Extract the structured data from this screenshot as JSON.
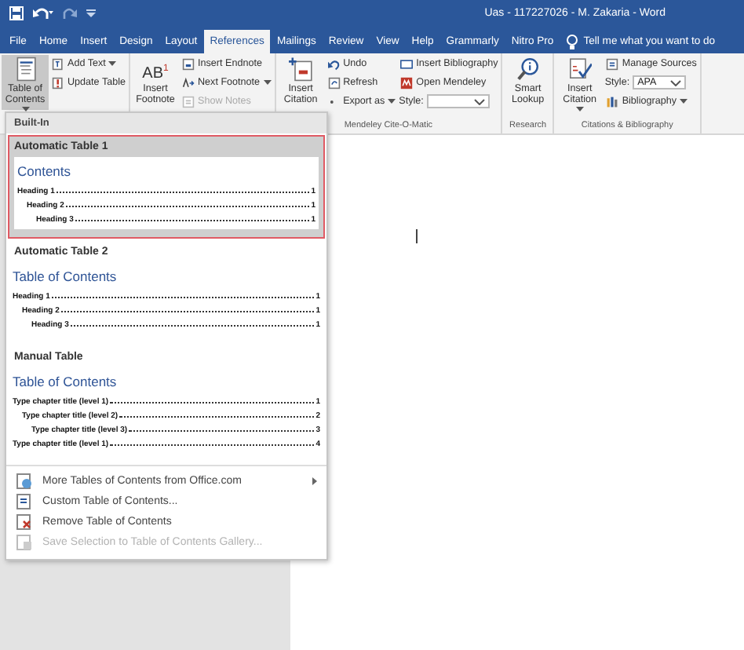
{
  "title_bar": {
    "title": "Uas - 117227026 - M. Zakaria  -  Word"
  },
  "tabs": [
    {
      "label": "File",
      "selected": false
    },
    {
      "label": "Home",
      "selected": false
    },
    {
      "label": "Insert",
      "selected": false
    },
    {
      "label": "Design",
      "selected": false
    },
    {
      "label": "Layout",
      "selected": false
    },
    {
      "label": "References",
      "selected": true
    },
    {
      "label": "Mailings",
      "selected": false
    },
    {
      "label": "Review",
      "selected": false
    },
    {
      "label": "View",
      "selected": false
    },
    {
      "label": "Help",
      "selected": false
    },
    {
      "label": "Grammarly",
      "selected": false
    },
    {
      "label": "Nitro Pro",
      "selected": false
    }
  ],
  "tell_me": "Tell me what you want to do",
  "ribbon_groups": [
    {
      "columns": [
        [
          {
            "kind": "large",
            "label": "Table of Contents",
            "dropdown": true,
            "pressed": true
          }
        ],
        [
          {
            "kind": "small",
            "label": "Add Text",
            "dropdown": true
          },
          {
            "kind": "small",
            "label": "Update Table"
          }
        ]
      ]
    },
    {
      "columns": [
        [
          {
            "kind": "large",
            "label": "Insert Footnote",
            "icon_text": "AB$^{1}$"
          }
        ],
        [
          {
            "kind": "small",
            "label": "Insert Endnote"
          },
          {
            "kind": "small",
            "label": "Next Footnote",
            "dropdown": true
          },
          {
            "kind": "small",
            "label": "Show Notes",
            "disabled": true
          }
        ]
      ]
    },
    {
      "label": "Mendeley Cite-O-Matic",
      "columns": [
        [
          {
            "kind": "large",
            "label": "Insert Citation"
          }
        ],
        [
          {
            "kind": "small",
            "label": "Undo"
          },
          {
            "kind": "small",
            "label": "Refresh"
          },
          {
            "kind": "small",
            "label": "Export as",
            "dropdown": true
          }
        ],
        [
          {
            "kind": "small",
            "label": "Insert Bibliography"
          },
          {
            "kind": "small",
            "label": "Open Mendeley"
          },
          {
            "kind": "combo",
            "label": "Style:"
          }
        ]
      ]
    },
    {
      "label": "Research",
      "columns": [
        [
          {
            "kind": "large",
            "label": "Smart Lookup"
          }
        ]
      ]
    },
    {
      "label": "Citations & Bibliography",
      "columns": [
        [
          {
            "kind": "large",
            "label": "Insert Citation",
            "dropdown": true
          }
        ],
        [
          {
            "kind": "small",
            "label": "Manage Sources"
          },
          {
            "kind": "combo",
            "label": "Style:",
            "value": "APA"
          },
          {
            "kind": "small",
            "label": "Bibliography",
            "dropdown": true
          }
        ]
      ]
    }
  ],
  "toc_menu": {
    "section": "Built-In",
    "gallery": [
      {
        "name": "Automatic Table 1",
        "selected": true,
        "heading": "Contents",
        "entries": [
          {
            "text": "Heading 1",
            "page": "1",
            "children": [
              {
                "text": "Heading 2",
                "page": "1",
                "children": [
                  {
                    "text": "Heading 3",
                    "page": "1"
                  }
                ]
              }
            ]
          }
        ]
      },
      {
        "name": "Automatic Table 2",
        "selected": false,
        "heading": "Table of Contents",
        "entries": [
          {
            "text": "Heading 1",
            "page": "1",
            "children": [
              {
                "text": "Heading 2",
                "page": "1",
                "children": [
                  {
                    "text": "Heading 3",
                    "page": "1"
                  }
                ]
              }
            ]
          }
        ]
      },
      {
        "name": "Manual Table",
        "selected": false,
        "heading": "Table of Contents",
        "entries": [
          {
            "text": "Type chapter title (level 1)",
            "page": "1",
            "children": [
              {
                "text": "Type chapter title (level 2)",
                "page": "2",
                "children": [
                  {
                    "text": "Type chapter title (level 3)",
                    "page": "3"
                  }
                ]
              }
            ]
          },
          {
            "text": "Type chapter title (level 1)",
            "page": "4"
          }
        ]
      }
    ],
    "commands": [
      {
        "label": "More Tables of Contents from Office.com",
        "disabled": false,
        "submenu": true
      },
      {
        "label": "Custom Table of Contents...",
        "disabled": false
      },
      {
        "label": "Remove Table of Contents",
        "disabled": false
      },
      {
        "label": "Save Selection to Table of Contents Gallery...",
        "disabled": true
      }
    ]
  }
}
